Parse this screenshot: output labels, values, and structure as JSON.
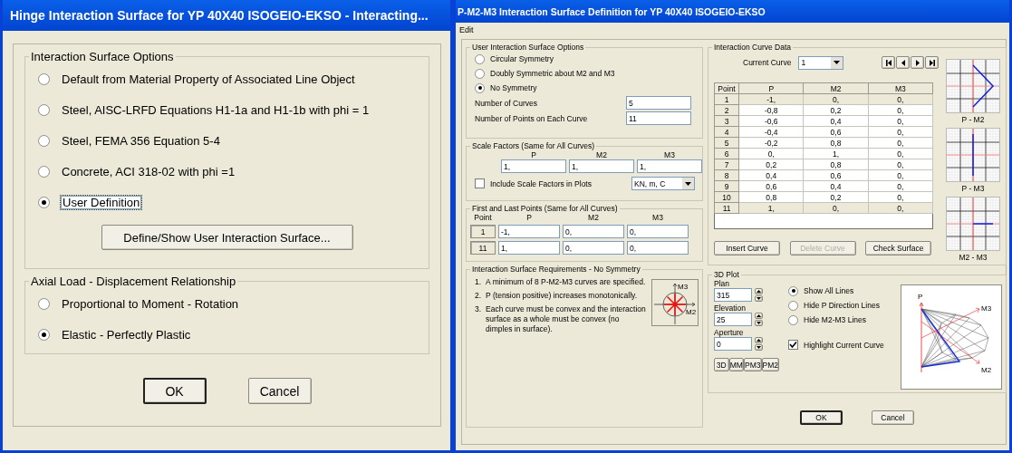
{
  "left_window": {
    "title": "Hinge Interaction Surface for YP 40X40 ISOGEIO-EKSO - Interacting...",
    "surface_options": {
      "label": "Interaction Surface Options",
      "options": [
        {
          "label": "Default from Material Property of Associated Line Object",
          "selected": false
        },
        {
          "label": "Steel, AISC-LRFD Equations H1-1a and H1-1b with phi = 1",
          "selected": false
        },
        {
          "label": "Steel, FEMA 356 Equation 5-4",
          "selected": false
        },
        {
          "label": "Concrete,  ACI 318-02 with phi =1",
          "selected": false
        },
        {
          "label": "User Definition",
          "selected": true
        }
      ]
    },
    "define_button": "Define/Show User Interaction Surface...",
    "axial": {
      "label": "Axial Load - Displacement Relationship",
      "options": [
        {
          "label": "Proportional to Moment - Rotation",
          "selected": false
        },
        {
          "label": "Elastic - Perfectly Plastic",
          "selected": true
        }
      ]
    },
    "buttons": [
      {
        "label": "OK",
        "focused": true
      },
      {
        "label": "Cancel",
        "focused": false
      }
    ]
  },
  "right_window": {
    "title": "P-M2-M3 Interaction Surface Definition for YP 40X40 ISOGEIO-EKSO",
    "menu": [
      "Edit"
    ],
    "user_options": {
      "label": "User Interaction Surface Options",
      "options": [
        {
          "label": "Circular Symmetry",
          "selected": false
        },
        {
          "label": "Doubly Symmetric about M2 and M3",
          "selected": false
        },
        {
          "label": "No Symmetry",
          "selected": true
        }
      ],
      "fields": [
        {
          "label": "Number of Curves",
          "value": "5"
        },
        {
          "label": "Number of Points on Each Curve",
          "value": "11"
        }
      ]
    },
    "scale_factors": {
      "label": "Scale Factors (Same for All Curves)",
      "columns": [
        "P",
        "M2",
        "M3"
      ],
      "values": [
        "1,",
        "1,",
        "1,"
      ],
      "include_in_plots": {
        "label": "Include Scale Factors in Plots",
        "checked": false
      },
      "units": "KN, m, C"
    },
    "first_last": {
      "label": "First and Last Points (Same for All Curves)",
      "columns": [
        "Point",
        "P",
        "M2",
        "M3"
      ],
      "rows": [
        [
          "1",
          "-1,",
          "0,",
          "0,"
        ],
        [
          "11",
          "1,",
          "0,",
          "0,"
        ]
      ]
    },
    "requirements": {
      "label": "Interaction Surface Requirements - No Symmetry",
      "items": [
        {
          "number": "1.",
          "text": "A minimum of 8 P-M2-M3 curves are specified."
        },
        {
          "number": "2.",
          "text": "P (tension positive) increases monotonically."
        },
        {
          "number": "3.",
          "text": "Each curve must be convex and the interaction surface as a whole must be convex (no dimples in surface)."
        }
      ],
      "diagram_labels": [
        "M3",
        "M2"
      ]
    },
    "curve_data": {
      "label": "Interaction Curve Data",
      "current_curve_label": "Current Curve",
      "current_curve": "1",
      "table": {
        "columns": [
          "Point",
          "P",
          "M2",
          "M3"
        ],
        "rows": [
          {
            "cells": [
              "1",
              "-1,",
              "0,",
              "0,"
            ],
            "locked": true
          },
          {
            "cells": [
              "2",
              "-0,8",
              "0,2",
              "0,"
            ],
            "locked": false
          },
          {
            "cells": [
              "3",
              "-0,6",
              "0,4",
              "0,"
            ],
            "locked": false
          },
          {
            "cells": [
              "4",
              "-0,4",
              "0,6",
              "0,"
            ],
            "locked": false
          },
          {
            "cells": [
              "5",
              "-0,2",
              "0,8",
              "0,"
            ],
            "locked": false
          },
          {
            "cells": [
              "6",
              "0,",
              "1,",
              "0,"
            ],
            "locked": false
          },
          {
            "cells": [
              "7",
              "0,2",
              "0,8",
              "0,"
            ],
            "locked": false
          },
          {
            "cells": [
              "8",
              "0,4",
              "0,6",
              "0,"
            ],
            "locked": false
          },
          {
            "cells": [
              "9",
              "0,6",
              "0,4",
              "0,"
            ],
            "locked": false
          },
          {
            "cells": [
              "10",
              "0,8",
              "0,2",
              "0,"
            ],
            "locked": false
          },
          {
            "cells": [
              "11",
              "1,",
              "0,",
              "0,"
            ],
            "locked": true
          }
        ]
      },
      "buttons": [
        {
          "label": "Insert Curve",
          "disabled": false
        },
        {
          "label": "Delete Curve",
          "disabled": true
        },
        {
          "label": "Check Surface",
          "disabled": false
        }
      ],
      "plots": [
        {
          "kind": "pm2",
          "caption": "P - M2"
        },
        {
          "kind": "pm3",
          "caption": "P - M3"
        },
        {
          "kind": "m2m3",
          "caption": "M2 - M3"
        }
      ]
    },
    "plot_3d": {
      "label": "3D Plot",
      "fields": [
        {
          "label": "Plan",
          "value": "315"
        },
        {
          "label": "Elevation",
          "value": "25"
        },
        {
          "label": "Aperture",
          "value": "0"
        }
      ],
      "options": [
        {
          "label": "Show All Lines",
          "selected": true
        },
        {
          "label": "Hide P Direction Lines",
          "selected": false
        },
        {
          "label": "Hide M2-M3 Lines",
          "selected": false
        }
      ],
      "highlight": {
        "label": "Highlight Current Curve",
        "checked": true
      },
      "view_buttons": [
        "3D",
        "MM",
        "PM3",
        "PM2"
      ],
      "axis_labels": [
        "P",
        "M3",
        "M2"
      ]
    },
    "buttons": [
      {
        "label": "OK",
        "focused": true
      },
      {
        "label": "Cancel",
        "focused": false
      }
    ]
  }
}
